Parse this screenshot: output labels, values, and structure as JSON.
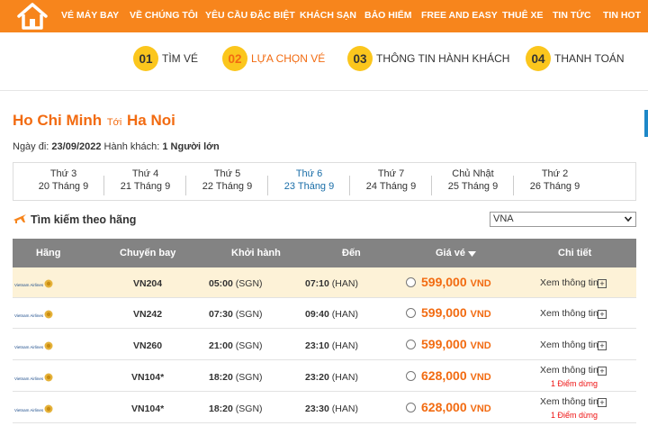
{
  "nav": {
    "items": [
      "VÉ MÁY BAY",
      "VỀ CHÚNG TÔI",
      "YÊU CẦU ĐẶC BIỆT",
      "KHÁCH SẠN",
      "BẢO HIỂM",
      "FREE AND EASY",
      "THUÊ XE",
      "TIN TỨC",
      "TIN HOT"
    ]
  },
  "steps": [
    {
      "num": "01",
      "label": "TÌM VÉ"
    },
    {
      "num": "02",
      "label": "LỰA CHỌN VÉ"
    },
    {
      "num": "03",
      "label": "THÔNG TIN HÀNH KHÁCH"
    },
    {
      "num": "04",
      "label": "THANH TOÁN"
    }
  ],
  "route": {
    "from": "Ho Chi Minh",
    "connector": "Tới",
    "to": "Ha Noi"
  },
  "info": {
    "date_label": "Ngày đi:",
    "date": "23/09/2022",
    "pax_label": "Hành khách:",
    "pax": "1 Người lớn"
  },
  "days": [
    {
      "weekday": "Thứ 3",
      "date": "20 Tháng 9"
    },
    {
      "weekday": "Thứ 4",
      "date": "21 Tháng 9"
    },
    {
      "weekday": "Thứ 5",
      "date": "22 Tháng 9"
    },
    {
      "weekday": "Thứ 6",
      "date": "23 Tháng 9"
    },
    {
      "weekday": "Thứ 7",
      "date": "24 Tháng 9"
    },
    {
      "weekday": "Chủ Nhật",
      "date": "25 Tháng 9"
    },
    {
      "weekday": "Thứ 2",
      "date": "26 Tháng 9"
    }
  ],
  "filter": {
    "label": "Tìm kiếm theo hãng",
    "selected": "VNA"
  },
  "table": {
    "headers": {
      "airline": "Hãng",
      "flight": "Chuyến bay",
      "depart": "Khởi hành",
      "arrive": "Đến",
      "price": "Giá vé",
      "detail": "Chi tiết"
    },
    "rows": [
      {
        "flight": "VN204",
        "dep_time": "05:00",
        "dep_code": "(SGN)",
        "arr_time": "07:10",
        "arr_code": "(HAN)",
        "price": "599,000",
        "currency": "VND",
        "detail": "Xem thông tin",
        "points": ""
      },
      {
        "flight": "VN242",
        "dep_time": "07:30",
        "dep_code": "(SGN)",
        "arr_time": "09:40",
        "arr_code": "(HAN)",
        "price": "599,000",
        "currency": "VND",
        "detail": "Xem thông tin",
        "points": ""
      },
      {
        "flight": "VN260",
        "dep_time": "21:00",
        "dep_code": "(SGN)",
        "arr_time": "23:10",
        "arr_code": "(HAN)",
        "price": "599,000",
        "currency": "VND",
        "detail": "Xem thông tin",
        "points": ""
      },
      {
        "flight": "VN104*",
        "dep_time": "18:20",
        "dep_code": "(SGN)",
        "arr_time": "23:20",
        "arr_code": "(HAN)",
        "price": "628,000",
        "currency": "VND",
        "detail": "Xem thông tin",
        "points": "1 Điểm dừng"
      },
      {
        "flight": "VN104*",
        "dep_time": "18:20",
        "dep_code": "(SGN)",
        "arr_time": "23:30",
        "arr_code": "(HAN)",
        "price": "628,000",
        "currency": "VND",
        "detail": "Xem thông tin",
        "points": "1 Điểm dừng"
      }
    ]
  },
  "colors": {
    "brand": "#f7851c",
    "accent": "#f26b11",
    "step_badge": "#fbc61d",
    "active_day": "#1a6ea8",
    "header_bg": "#838383",
    "highlight_row": "#fdf2d7"
  }
}
